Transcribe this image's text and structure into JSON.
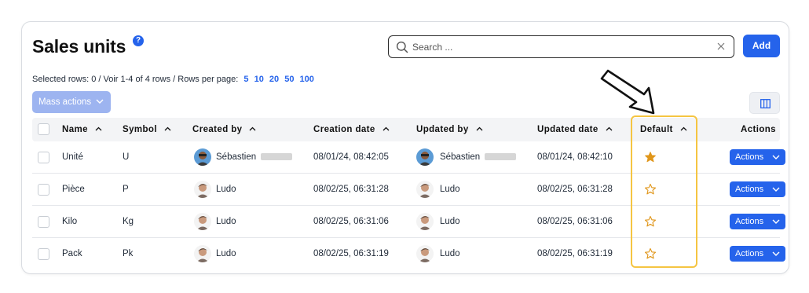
{
  "page": {
    "title": "Sales units",
    "help_icon": "help-icon"
  },
  "search": {
    "placeholder": "Search ..."
  },
  "toolbar": {
    "add_label": "Add",
    "mass_actions_label": "Mass actions"
  },
  "pager": {
    "selected_text": "Selected rows: 0 /",
    "range_text": "Voir 1-4 of 4 rows /",
    "rows_per_page_label": "Rows per page:",
    "rows_per_page_options": [
      "5",
      "10",
      "20",
      "50",
      "100"
    ]
  },
  "table": {
    "columns": [
      "Name",
      "Symbol",
      "Created by",
      "Creation date",
      "Updated by",
      "Updated date",
      "Default",
      "Actions"
    ],
    "rows": [
      {
        "name": "Unité",
        "symbol": "U",
        "created_by": "Sébastien",
        "creation_date": "08/01/24, 08:42:05",
        "updated_by": "Sébastien",
        "updated_date": "08/01/24, 08:42:10",
        "default": true,
        "action_label": "Actions"
      },
      {
        "name": "Pièce",
        "symbol": "P",
        "created_by": "Ludo",
        "creation_date": "08/02/25, 06:31:28",
        "updated_by": "Ludo",
        "updated_date": "08/02/25, 06:31:28",
        "default": false,
        "action_label": "Actions"
      },
      {
        "name": "Kilo",
        "symbol": "Kg",
        "created_by": "Ludo",
        "creation_date": "08/02/25, 06:31:06",
        "updated_by": "Ludo",
        "updated_date": "08/02/25, 06:31:06",
        "default": false,
        "action_label": "Actions"
      },
      {
        "name": "Pack",
        "symbol": "Pk",
        "created_by": "Ludo",
        "creation_date": "08/02/25, 06:31:19",
        "updated_by": "Ludo",
        "updated_date": "08/02/25, 06:31:19",
        "default": false,
        "action_label": "Actions"
      }
    ]
  },
  "colors": {
    "accent": "#2563eb",
    "mass_actions_bg": "#9db4f0",
    "highlight": "#f5c542",
    "star": "#e0961a"
  },
  "icons": {
    "search": "search-icon",
    "clear": "close-icon",
    "columns": "columns-icon",
    "sort": "chevron-up-icon",
    "default_star": "star-icon"
  }
}
